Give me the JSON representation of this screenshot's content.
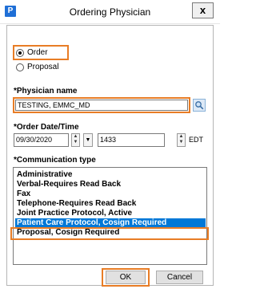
{
  "window": {
    "title": "Ordering Physician",
    "app_icon_letter": "P",
    "close_glyph": "x"
  },
  "order_type": {
    "options": [
      {
        "label": "Order",
        "selected": true
      },
      {
        "label": "Proposal",
        "selected": false
      }
    ]
  },
  "physician": {
    "label": "*Physician name",
    "value": "TESTING, EMMC_MD",
    "search_icon": "search-icon"
  },
  "order_datetime": {
    "label": "*Order Date/Time",
    "date": "09/30/2020",
    "time": "1433",
    "timezone": "EDT"
  },
  "communication": {
    "label": "*Communication type",
    "items": [
      "Administrative",
      "Verbal-Requires Read Back",
      "Fax",
      "Telephone-Requires Read Back",
      "Joint Practice Protocol, Active",
      "Patient Care Protocol, Cosign Required",
      "Proposal, Cosign Required"
    ],
    "selected_index": 5
  },
  "buttons": {
    "ok": "OK",
    "cancel": "Cancel"
  },
  "colors": {
    "highlight_outline": "#e87d26",
    "selection": "#0078d7",
    "app_icon": "#1f6fd6"
  }
}
